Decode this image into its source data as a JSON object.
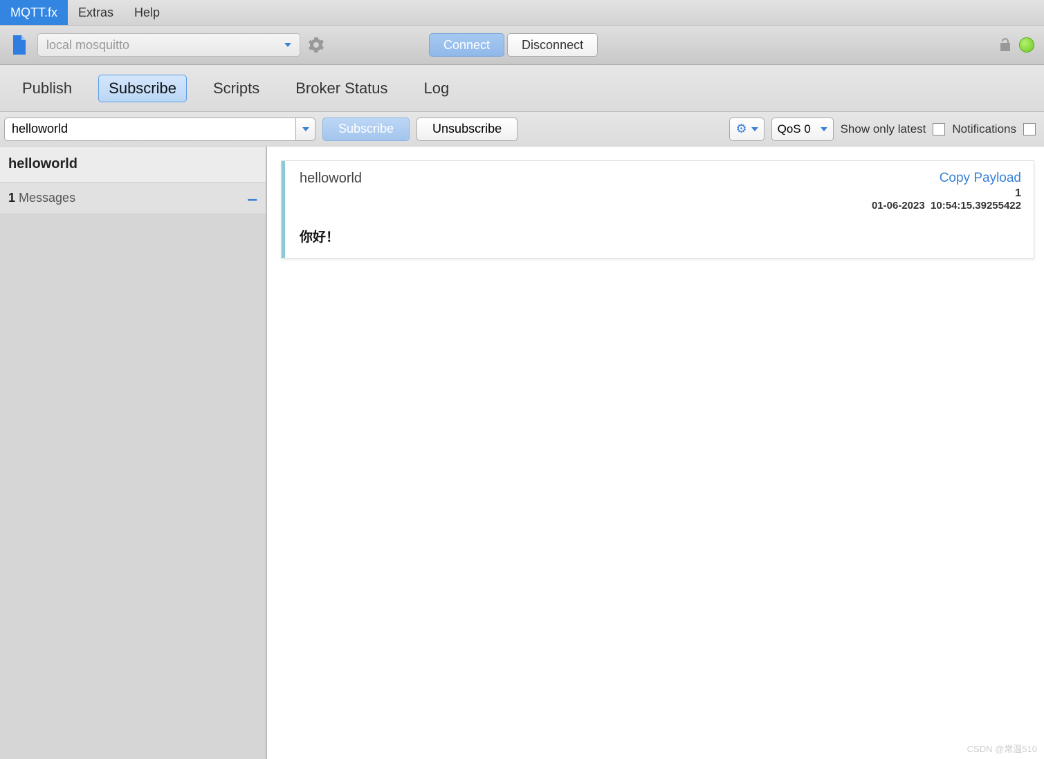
{
  "menu": {
    "app": "MQTT.fx",
    "extras": "Extras",
    "help": "Help"
  },
  "conn": {
    "profile_placeholder": "local mosquitto",
    "connect": "Connect",
    "disconnect": "Disconnect"
  },
  "tabs": {
    "publish": "Publish",
    "subscribe": "Subscribe",
    "scripts": "Scripts",
    "broker_status": "Broker Status",
    "log": "Log"
  },
  "subbar": {
    "topic_value": "helloworld",
    "subscribe": "Subscribe",
    "unsubscribe": "Unsubscribe",
    "qos": "QoS 0",
    "show_latest": "Show only latest",
    "notifications": "Notifications"
  },
  "sidebar": {
    "topic": "helloworld",
    "msg_count": "1",
    "msg_label": "Messages"
  },
  "message": {
    "topic": "helloworld",
    "copy": "Copy Payload",
    "id": "1",
    "date": "01-06-2023",
    "time": "10:54:15.39255422",
    "body": "你好！"
  },
  "watermark": "CSDN @常温510"
}
